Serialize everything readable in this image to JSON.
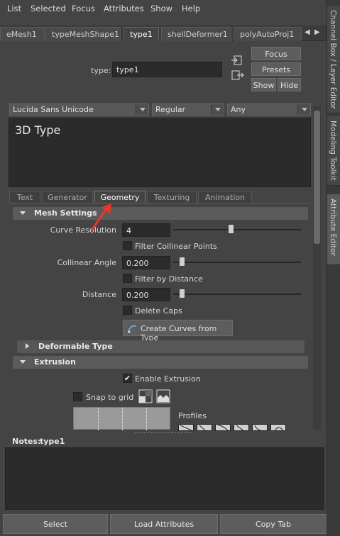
{
  "menu": [
    "List",
    "Selected",
    "Focus",
    "Attributes",
    "Show",
    "Help"
  ],
  "side_tabs": [
    "Channel Box / Layer Editor",
    "Modeling Toolkit",
    "Attribute Editor"
  ],
  "node_tabs": [
    "eMesh1",
    "typeMeshShape1",
    "type1",
    "shellDeformer1",
    "polyAutoProj1"
  ],
  "type_field": {
    "label": "type:",
    "value": "type1"
  },
  "buttons": {
    "focus": "Focus",
    "presets": "Presets",
    "show": "Show",
    "hide": "Hide"
  },
  "font": {
    "family": "Lucida Sans Unicode",
    "style": "Regular",
    "writing": "Any"
  },
  "text_value": "3D Type",
  "sub_tabs": [
    "Text",
    "Generator",
    "Geometry",
    "Texturing",
    "Animation"
  ],
  "mesh_settings": {
    "title": "Mesh Settings",
    "curve_resolution": {
      "label": "Curve Resolution",
      "value": "4",
      "slider": 0.45
    },
    "filter_collinear": {
      "label": "Filter Collinear Points",
      "checked": false
    },
    "collinear_angle": {
      "label": "Collinear Angle",
      "value": "0.200",
      "slider": 0.05
    },
    "filter_distance": {
      "label": "Filter by Distance",
      "checked": false
    },
    "distance": {
      "label": "Distance",
      "value": "0.200",
      "slider": 0.05
    },
    "delete_caps": {
      "label": "Delete Caps",
      "checked": false
    },
    "create_curves": "Create Curves from Type"
  },
  "deformable_type": {
    "title": "Deformable Type"
  },
  "extrusion": {
    "title": "Extrusion",
    "enable": {
      "label": "Enable Extrusion",
      "checked": true
    },
    "snap": {
      "label": "Snap to grid",
      "checked": false
    },
    "profiles_label": "Profiles"
  },
  "notes": {
    "label": "Notes:",
    "node": "type1"
  },
  "bottom": {
    "select": "Select",
    "load": "Load Attributes",
    "copy": "Copy Tab"
  },
  "colors": {
    "panel": "#444444",
    "field": "#2b2b2b",
    "section": "#5b5b5b",
    "annotation_arrow": "#e8362a"
  }
}
